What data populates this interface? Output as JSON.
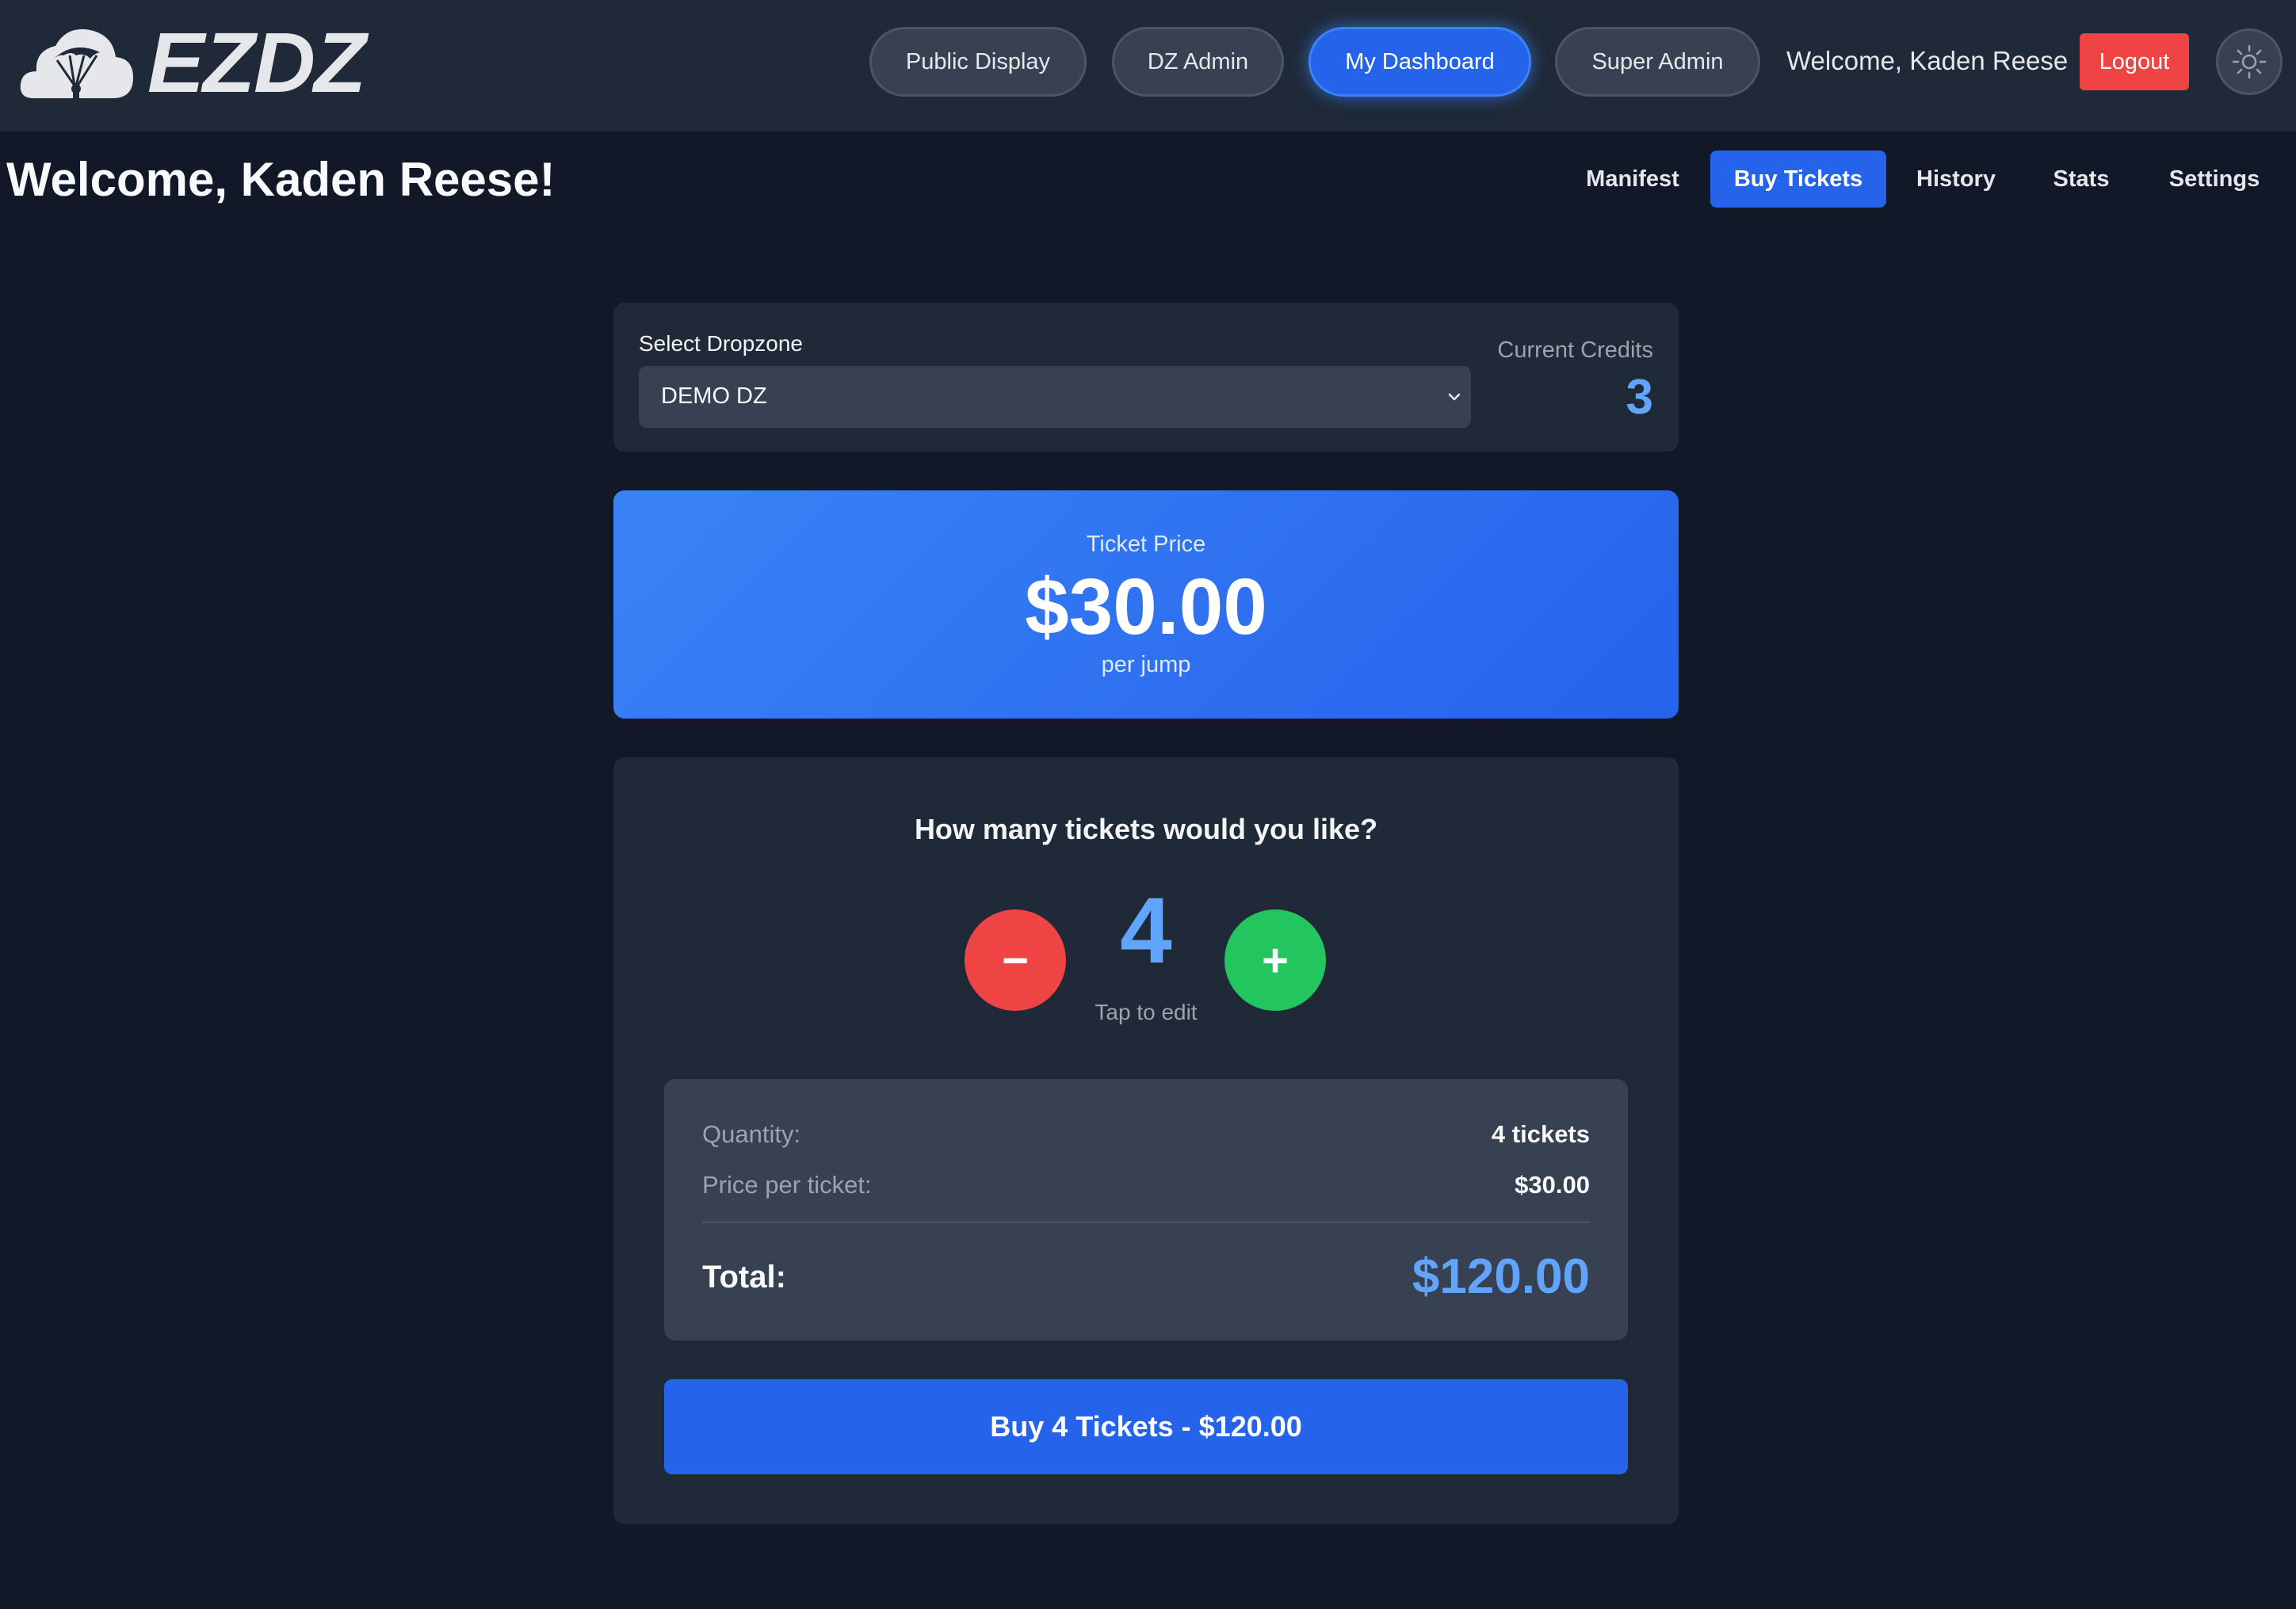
{
  "app": {
    "brand": "EZDZ",
    "logo_icon": "cloud-parachute-icon"
  },
  "nav": {
    "items": [
      {
        "label": "Public Display"
      },
      {
        "label": "DZ Admin"
      },
      {
        "label": "My Dashboard"
      },
      {
        "label": "Super Admin"
      }
    ],
    "active": "My Dashboard",
    "welcome": "Welcome, Kaden Reese",
    "logout_label": "Logout",
    "theme_icon": "sun-icon"
  },
  "page": {
    "title": "Welcome, Kaden Reese!",
    "tabs": [
      {
        "label": "Manifest"
      },
      {
        "label": "Buy Tickets"
      },
      {
        "label": "History"
      },
      {
        "label": "Stats"
      },
      {
        "label": "Settings"
      }
    ],
    "active_tab": "Buy Tickets"
  },
  "dropzone": {
    "label": "Select Dropzone",
    "selected": "DEMO DZ",
    "credits_label": "Current Credits",
    "credits_value": "3"
  },
  "price": {
    "label": "Ticket Price",
    "value": "$30.00",
    "unit": "per jump"
  },
  "quantity": {
    "question": "How many tickets would you like?",
    "minus_label": "−",
    "plus_label": "+",
    "value": "4",
    "hint": "Tap to edit"
  },
  "summary": {
    "quantity_label": "Quantity:",
    "quantity_value": "4 tickets",
    "price_label": "Price per ticket:",
    "price_value": "$30.00",
    "total_label": "Total:",
    "total_value": "$120.00"
  },
  "buy_button": "Buy 4 Tickets - $120.00",
  "colors": {
    "background": "#111827",
    "surface": "#1f2937",
    "primary": "#2563eb",
    "accent_text": "#60a5fa",
    "danger": "#ef4444",
    "success": "#22c55e"
  }
}
